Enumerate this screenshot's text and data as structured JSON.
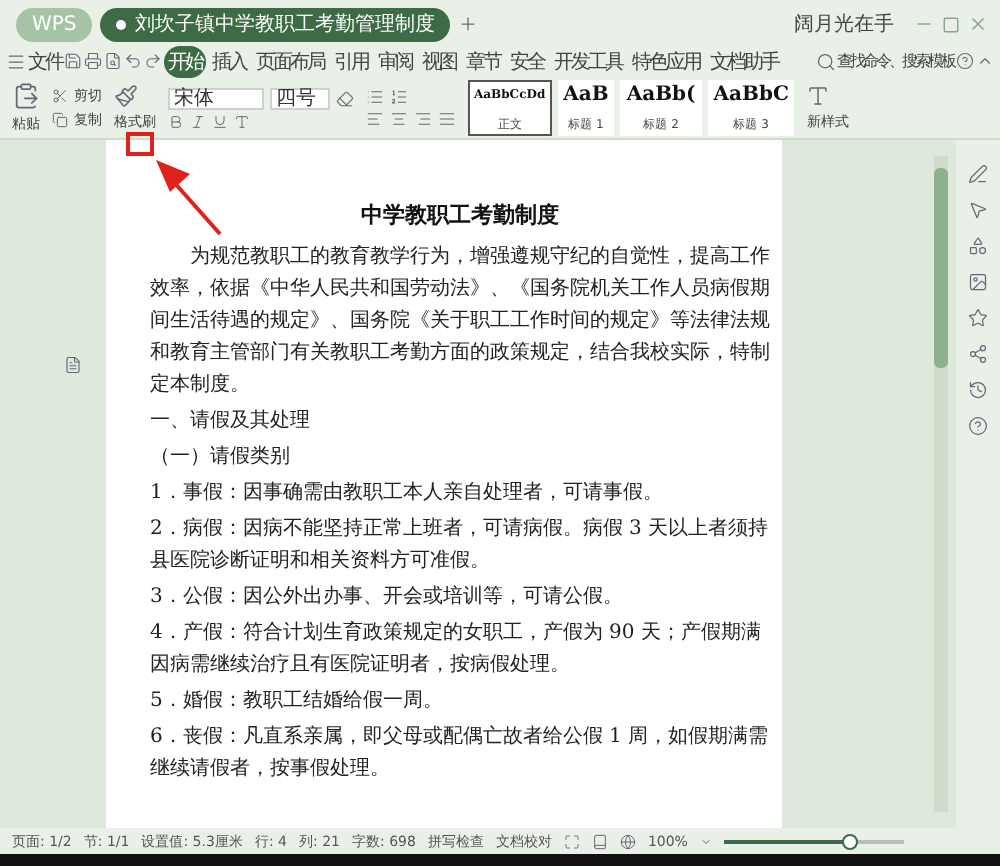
{
  "tabs": [
    {
      "label": "WPS",
      "kind": "home",
      "selected": false
    },
    {
      "label": "刘坎子镇中学教职工考勤管理制度",
      "kind": "doc",
      "selected": true
    }
  ],
  "user": {
    "name": "阔月光在手"
  },
  "menu": {
    "file": "文件",
    "items": [
      {
        "label": "开始",
        "selected": true
      },
      {
        "label": "插入",
        "selected": false
      },
      {
        "label": "页面布局",
        "selected": false
      },
      {
        "label": "引用",
        "selected": false
      },
      {
        "label": "审阅",
        "selected": false
      },
      {
        "label": "视图",
        "selected": false
      },
      {
        "label": "章节",
        "selected": false
      },
      {
        "label": "安全",
        "selected": false
      },
      {
        "label": "开发工具",
        "selected": false
      },
      {
        "label": "特色应用",
        "selected": false
      },
      {
        "label": "文档助手",
        "selected": false
      }
    ],
    "search_placeholder": "查找命令、搜索模板"
  },
  "ribbon": {
    "paste": "粘贴",
    "cut": "剪切",
    "copy": "复制",
    "format_painter": "格式刷",
    "font": "宋体",
    "size": "四号",
    "styles": [
      {
        "preview": "AaBbCcDd",
        "label": "正文",
        "selected": true
      },
      {
        "preview": "AaB",
        "label": "标题 1",
        "selected": false
      },
      {
        "preview": "AaBb(",
        "label": "标题 2",
        "selected": false
      },
      {
        "preview": "AaBbC",
        "label": "标题 3",
        "selected": false
      }
    ],
    "new_style": "新样式"
  },
  "document": {
    "title": "中学教职工考勤制度",
    "paragraphs": [
      {
        "text": "为规范教职工的教育教学行为，增强遵规守纪的自觉性，提高工作效率，依据《中华人民共和国劳动法》、《国务院机关工作人员病假期间生活待遇的规定》、国务院《关于职工工作时间的规定》等法律法规和教育主管部门有关教职工考勤方面的政策规定，结合我校实际，特制定本制度。",
        "indent": true
      },
      {
        "text": "一、请假及其处理",
        "indent": false
      },
      {
        "text": "（一）请假类别",
        "indent": false
      },
      {
        "text": "1．事假：因事确需由教职工本人亲自处理者，可请事假。",
        "indent": false
      },
      {
        "text": "2．病假：因病不能坚持正常上班者，可请病假。病假 3 天以上者须持县医院诊断证明和相关资料方可准假。",
        "indent": false
      },
      {
        "text": "3．公假：因公外出办事、开会或培训等，可请公假。",
        "indent": false
      },
      {
        "text": "4．产假：符合计划生育政策规定的女职工，产假为 90 天；产假期满因病需继续治疗且有医院证明者，按病假处理。",
        "indent": false
      },
      {
        "text": "5．婚假：教职工结婚给假一周。",
        "indent": false
      },
      {
        "text": "6．丧假：凡直系亲属，即父母或配偶亡故者给公假 1 周，如假期满需继续请假者，按事假处理。",
        "indent": false
      }
    ]
  },
  "status_bar": {
    "items": [
      "页面: 1/2",
      "节: 1/1",
      "设置值: 5.3厘米",
      "行: 4",
      "列: 21",
      "字数: 698"
    ],
    "spell_check": "拼写检查",
    "proofread": "文档校对",
    "zoom": "100%",
    "zoom_slider": {
      "level": 0.7
    }
  }
}
